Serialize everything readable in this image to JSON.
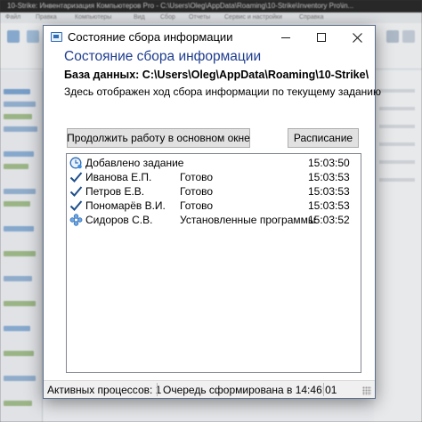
{
  "background_app": {
    "title": "10-Strike: Инвентаризация Компьютеров Pro - C:\\Users\\Oleg\\AppData\\Roaming\\10-Strike\\Inventory Pro\\in...",
    "menu": [
      "Файл",
      "Правка",
      "Компьютеры",
      "Вид",
      "Сбор",
      "Отчеты",
      "Сервис и настройки",
      "Справка"
    ]
  },
  "dialog": {
    "window_title": "Состояние сбора информации",
    "heading": "Состояние сбора информации",
    "database_line": "База данных: C:\\Users\\Oleg\\AppData\\Roaming\\10-Strike\\",
    "description": "Здесь отображен ход сбора информации по текущему заданию",
    "buttons": {
      "continue_label": "Продолжить работу в основном окне",
      "schedule_label": "Расписание"
    },
    "log": [
      {
        "icon": "clock-icon",
        "name": "Добавлено задание",
        "status": "",
        "time": "15:03:50"
      },
      {
        "icon": "checkmark-icon",
        "name": "Иванова Е.П.",
        "status": "Готово",
        "time": "15:03:53"
      },
      {
        "icon": "checkmark-icon",
        "name": "Петров Е.В.",
        "status": "Готово",
        "time": "15:03:53"
      },
      {
        "icon": "checkmark-icon",
        "name": "Пономарёв В.И.",
        "status": "Готово",
        "time": "15:03:53"
      },
      {
        "icon": "network-nodes-icon",
        "name": "Сидоров С.В.",
        "status": "Установленные программы",
        "time": "15:03:52"
      }
    ],
    "statusbar": {
      "active_processes": "Активных процессов: 1",
      "queue_text": "Очередь сформирована в 14:46:01"
    }
  },
  "colors": {
    "heading": "#1e3d8f",
    "check": "#1f4e8c",
    "dialog_border": "#5b6f8a"
  }
}
